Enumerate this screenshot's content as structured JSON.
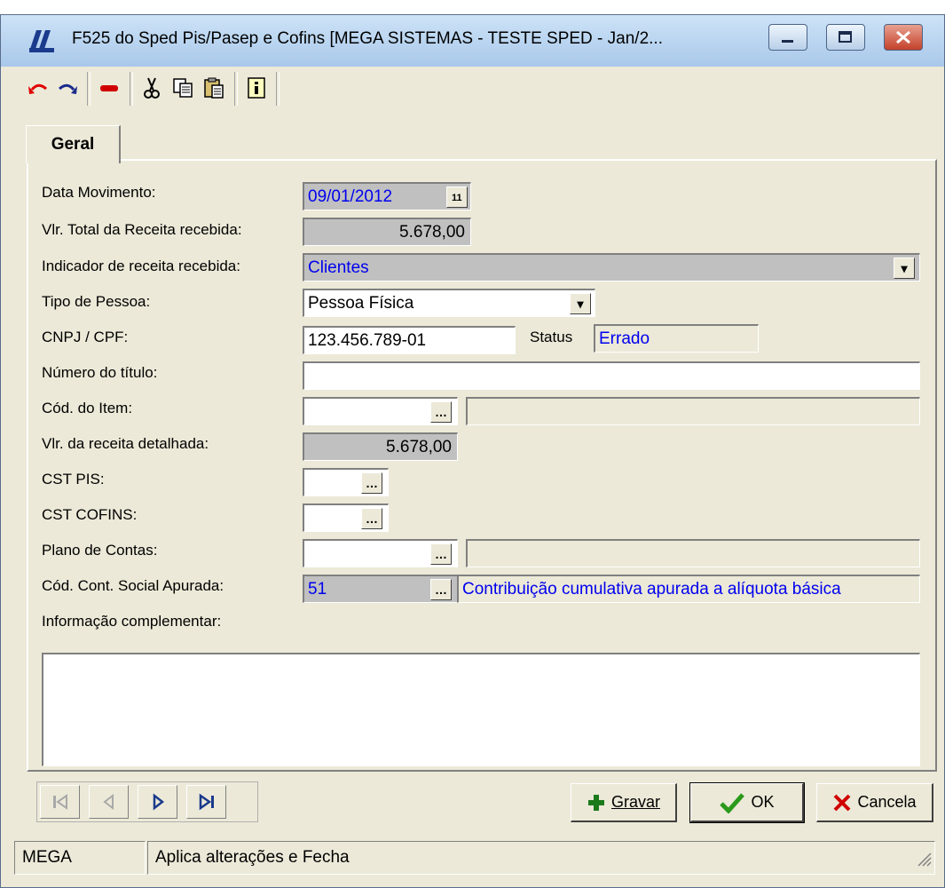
{
  "window": {
    "title": "F525 do Sped Pis/Pasep e Cofins [MEGA SISTEMAS - TESTE SPED - Jan/2...",
    "logo": "mega-logo-icon"
  },
  "toolbar": {
    "icons": [
      "undo-icon",
      "redo-icon",
      "remove-icon",
      "cut-icon",
      "copy-icon",
      "paste-icon",
      "info-icon"
    ]
  },
  "tabs": [
    {
      "label": "Geral"
    }
  ],
  "form": {
    "data_movimento": {
      "label": "Data Movimento:",
      "value": "09/01/2012"
    },
    "vlr_total": {
      "label": "Vlr. Total da Receita recebida:",
      "value": "5.678,00"
    },
    "indicador": {
      "label": "Indicador de receita recebida:",
      "value": "Clientes"
    },
    "tipo_pessoa": {
      "label": "Tipo de Pessoa:",
      "value": "Pessoa Física"
    },
    "cnpj": {
      "label": "CNPJ / CPF:",
      "value": "123.456.789-01"
    },
    "status": {
      "label": "Status",
      "value": "Errado"
    },
    "numero_titulo": {
      "label": "Número do título:",
      "value": ""
    },
    "cod_item": {
      "label": "Cód. do Item:",
      "value": "",
      "description": ""
    },
    "vlr_receita_detalhada": {
      "label": "Vlr. da receita detalhada:",
      "value": "5.678,00"
    },
    "cst_pis": {
      "label": "CST PIS:",
      "value": ""
    },
    "cst_cofins": {
      "label": "CST COFINS:",
      "value": ""
    },
    "plano_contas": {
      "label": "Plano de Contas:",
      "value": "",
      "description": ""
    },
    "cod_cont_social": {
      "label": "Cód. Cont. Social Apurada:",
      "value": "51",
      "description": "Contribuição cumulativa apurada a alíquota básica"
    },
    "info_complementar": {
      "label": "Informação complementar:",
      "value": ""
    }
  },
  "buttons": {
    "gravar": "Gravar",
    "ok": "OK",
    "cancela": "Cancela"
  },
  "statusbar": {
    "left": "MEGA",
    "message": "Aplica alterações e Fecha"
  },
  "colors": {
    "accent": "#0000ee",
    "field_gray": "#c0c0c0",
    "window_bg": "#ece9d8"
  }
}
